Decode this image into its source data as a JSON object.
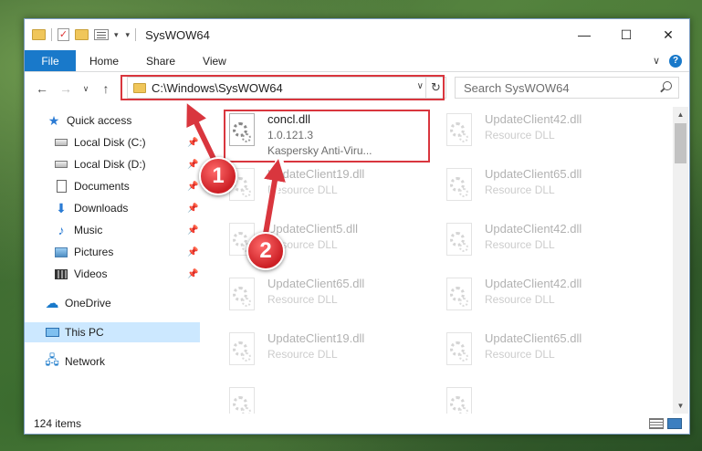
{
  "window": {
    "title": "SysWOW64",
    "controls": {
      "minimize": "—",
      "maximize": "☐",
      "close": "✕"
    }
  },
  "ribbon": {
    "file_tab": "File",
    "tabs": [
      "Home",
      "Share",
      "View"
    ],
    "help": "?"
  },
  "nav": {
    "back": "←",
    "forward": "→",
    "recent": "∨",
    "up": "↑",
    "address": "C:\\Windows\\SysWOW64",
    "refresh": "↻",
    "search_placeholder": "Search SysWOW64"
  },
  "sidebar": {
    "items": [
      {
        "label": "Quick access",
        "icon": "star-icon",
        "pinned": false
      },
      {
        "label": "Local Disk (C:)",
        "icon": "disk-icon",
        "pinned": true
      },
      {
        "label": "Local Disk (D:)",
        "icon": "disk-icon",
        "pinned": true
      },
      {
        "label": "Documents",
        "icon": "documents-icon",
        "pinned": true
      },
      {
        "label": "Downloads",
        "icon": "downloads-icon",
        "pinned": true
      },
      {
        "label": "Music",
        "icon": "music-icon",
        "pinned": true
      },
      {
        "label": "Pictures",
        "icon": "pictures-icon",
        "pinned": true
      },
      {
        "label": "Videos",
        "icon": "videos-icon",
        "pinned": true
      },
      {
        "label": "OneDrive",
        "icon": "onedrive-icon",
        "pinned": false
      },
      {
        "label": "This PC",
        "icon": "this-pc-icon",
        "pinned": false,
        "selected": true
      },
      {
        "label": "Network",
        "icon": "network-icon",
        "pinned": false
      }
    ],
    "pin_glyph": "📌"
  },
  "files": [
    {
      "name": "concl.dll",
      "line1": "1.0.121.3",
      "line2": "Kaspersky Anti-Viru...",
      "highlighted": true
    },
    {
      "name": "UpdateClient42.dll",
      "line1": "Resource DLL",
      "line2": "",
      "highlighted": false
    },
    {
      "name": "UpdateClient19.dll",
      "line1": "Resource DLL",
      "line2": "",
      "highlighted": false
    },
    {
      "name": "UpdateClient65.dll",
      "line1": "Resource DLL",
      "line2": "",
      "highlighted": false
    },
    {
      "name": "UpdateClient5.dll",
      "line1": "Resource DLL",
      "line2": "",
      "highlighted": false
    },
    {
      "name": "UpdateClient42.dll",
      "line1": "Resource DLL",
      "line2": "",
      "highlighted": false
    },
    {
      "name": "UpdateClient65.dll",
      "line1": "Resource DLL",
      "line2": "",
      "highlighted": false
    },
    {
      "name": "UpdateClient42.dll",
      "line1": "Resource DLL",
      "line2": "",
      "highlighted": false
    },
    {
      "name": "UpdateClient19.dll",
      "line1": "Resource DLL",
      "line2": "",
      "highlighted": false
    },
    {
      "name": "UpdateClient65.dll",
      "line1": "Resource DLL",
      "line2": "",
      "highlighted": false
    },
    {
      "name": "",
      "line1": "",
      "line2": "",
      "highlighted": false
    },
    {
      "name": "",
      "line1": "",
      "line2": "",
      "highlighted": false
    }
  ],
  "status": {
    "count": "124 items"
  },
  "annotations": {
    "badge1": "1",
    "badge2": "2",
    "color": "#d9363e"
  }
}
